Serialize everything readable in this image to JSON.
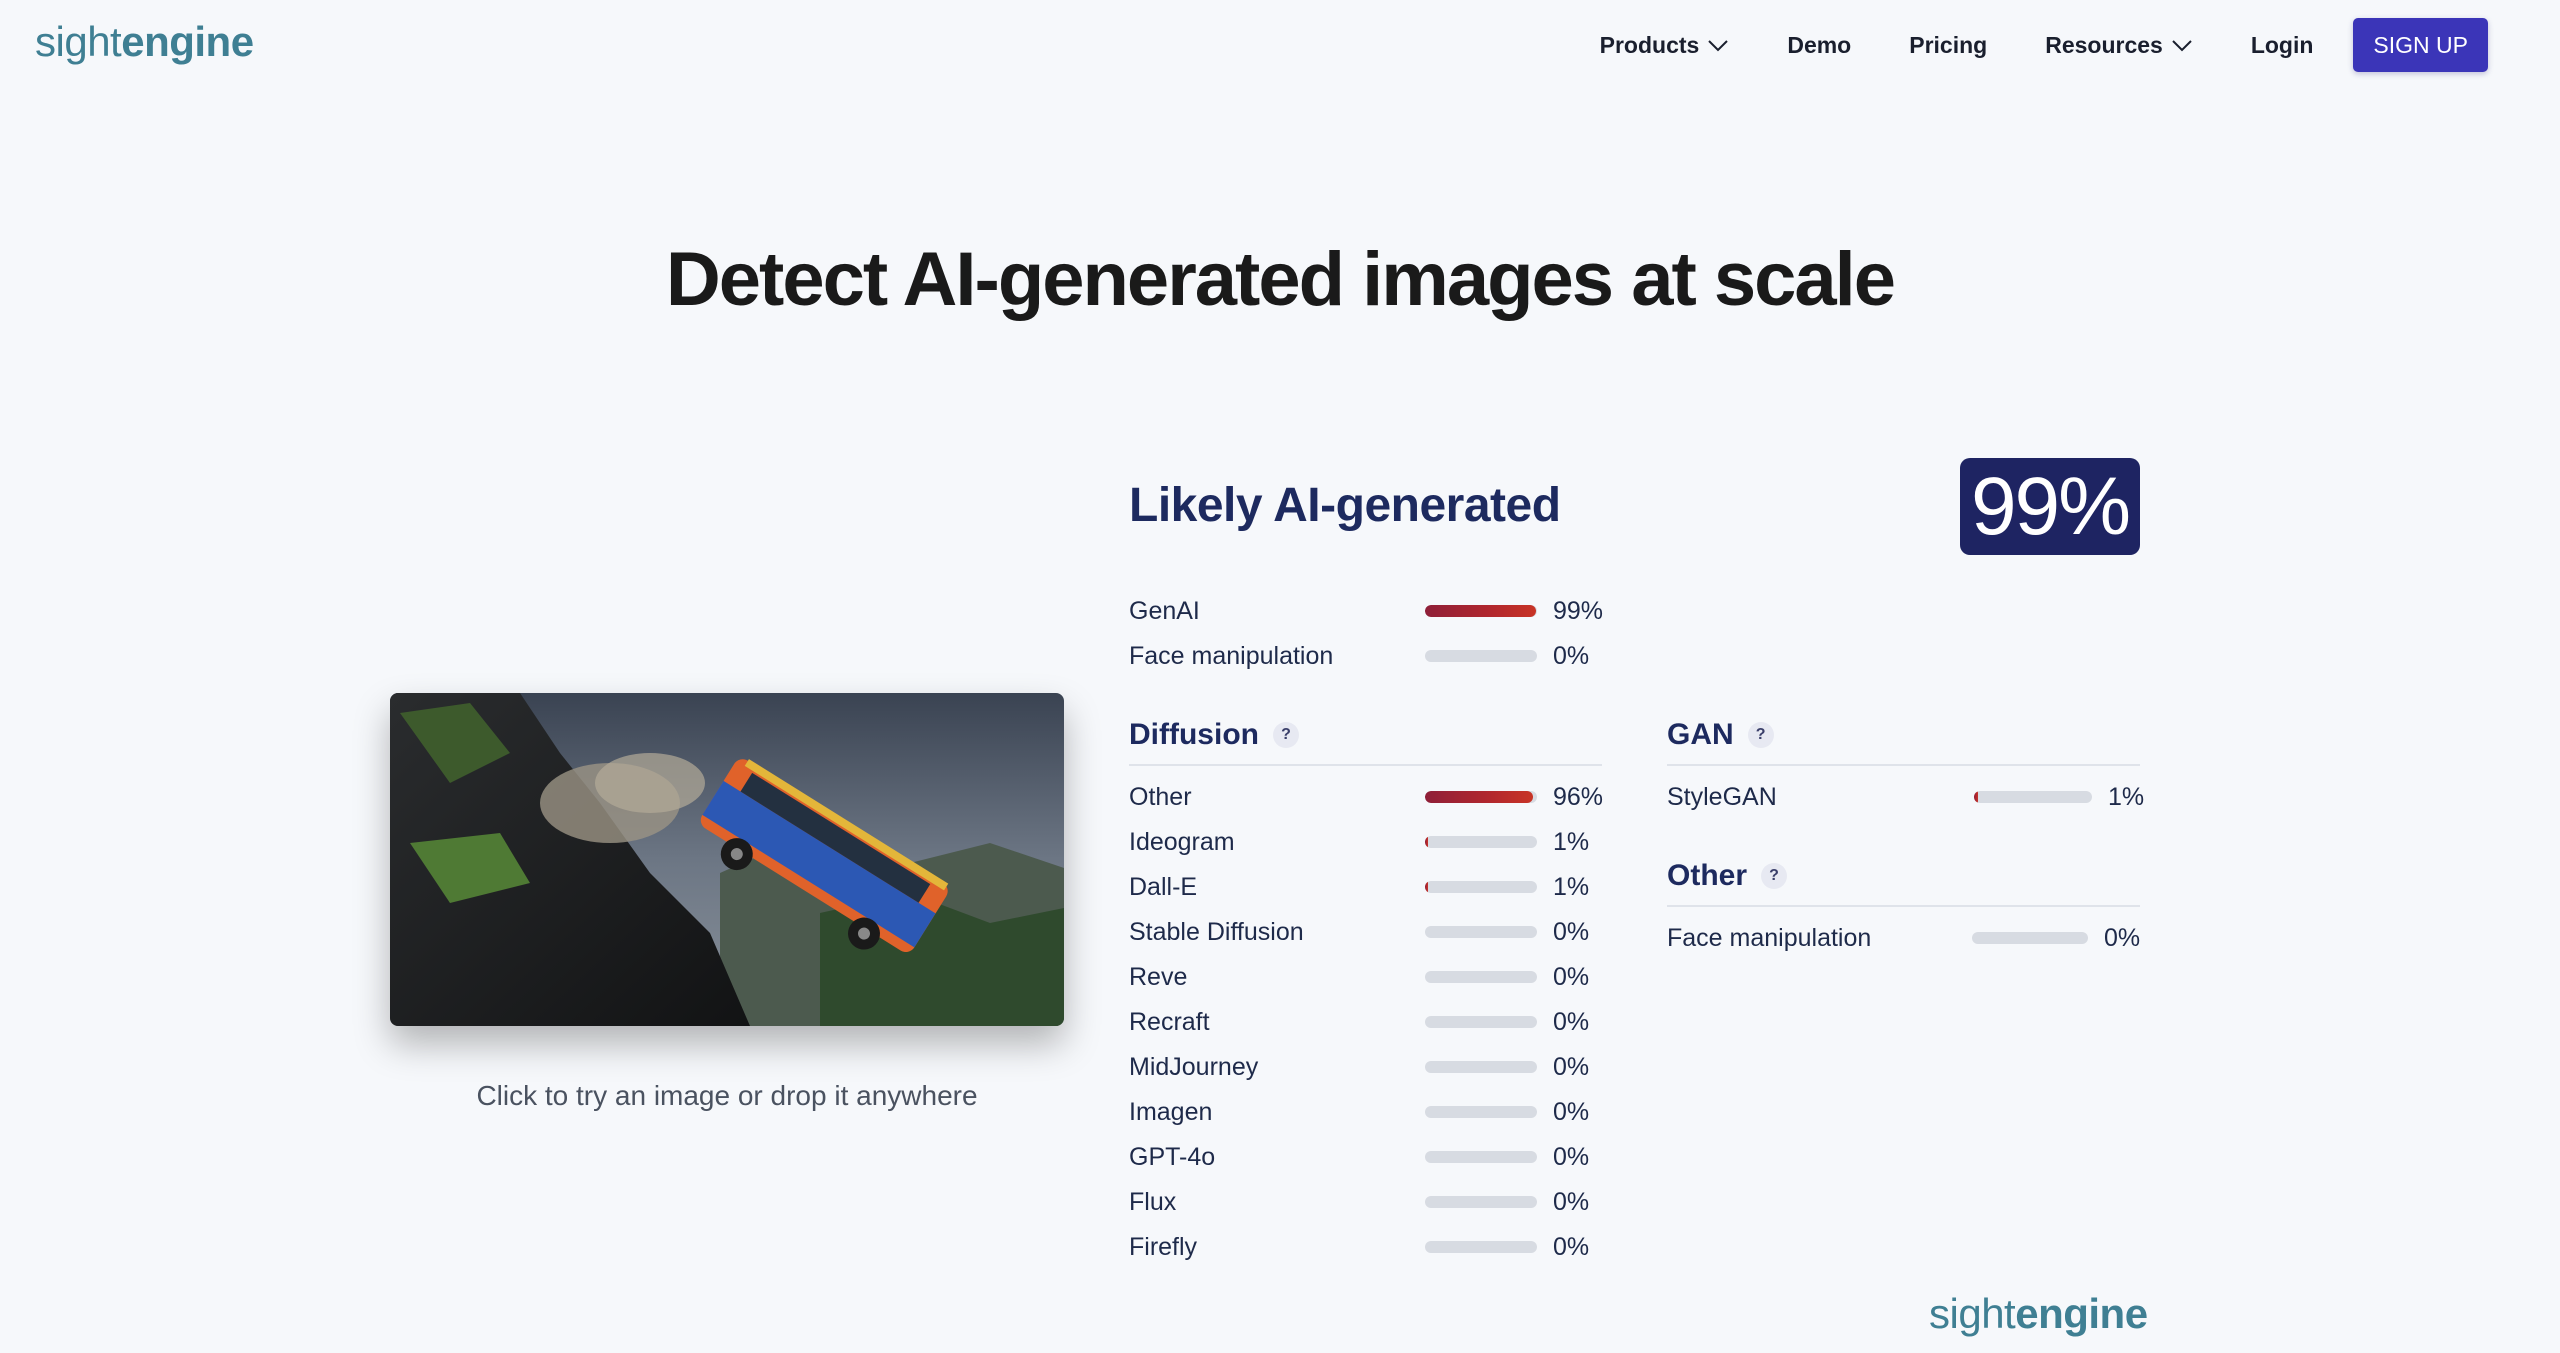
{
  "brand": {
    "part1": "sight",
    "part2": "engine",
    "color": "#3f7f93"
  },
  "nav": {
    "items": [
      {
        "label": "Products",
        "dropdown": true
      },
      {
        "label": "Demo",
        "dropdown": false
      },
      {
        "label": "Pricing",
        "dropdown": false
      },
      {
        "label": "Resources",
        "dropdown": true
      },
      {
        "label": "Login",
        "dropdown": false
      }
    ],
    "signup_label": "SIGN UP",
    "signup_color": "#3b35b8"
  },
  "hero": {
    "title": "Detect AI-generated images at scale"
  },
  "sample": {
    "caption": "Click to try an image or drop it anywhere"
  },
  "result": {
    "verdict": "Likely AI-generated",
    "score": "99%",
    "score_color": "#1e2462",
    "summary": [
      {
        "label": "GenAI",
        "value": 99,
        "pct": "99%"
      },
      {
        "label": "Face manipulation",
        "value": 0,
        "pct": "0%"
      }
    ],
    "diffusion": {
      "title": "Diffusion",
      "help": "?",
      "rows": [
        {
          "label": "Other",
          "value": 96,
          "pct": "96%"
        },
        {
          "label": "Ideogram",
          "value": 1,
          "pct": "1%"
        },
        {
          "label": "Dall-E",
          "value": 1,
          "pct": "1%"
        },
        {
          "label": "Stable Diffusion",
          "value": 0,
          "pct": "0%"
        },
        {
          "label": "Reve",
          "value": 0,
          "pct": "0%"
        },
        {
          "label": "Recraft",
          "value": 0,
          "pct": "0%"
        },
        {
          "label": "MidJourney",
          "value": 0,
          "pct": "0%"
        },
        {
          "label": "Imagen",
          "value": 0,
          "pct": "0%"
        },
        {
          "label": "GPT-4o",
          "value": 0,
          "pct": "0%"
        },
        {
          "label": "Flux",
          "value": 0,
          "pct": "0%"
        },
        {
          "label": "Firefly",
          "value": 0,
          "pct": "0%"
        }
      ]
    },
    "gan": {
      "title": "GAN",
      "help": "?",
      "rows": [
        {
          "label": "StyleGAN",
          "value": 1,
          "pct": "1%"
        }
      ]
    },
    "other": {
      "title": "Other",
      "help": "?",
      "rows": [
        {
          "label": "Face manipulation",
          "value": 0,
          "pct": "0%"
        }
      ]
    }
  }
}
